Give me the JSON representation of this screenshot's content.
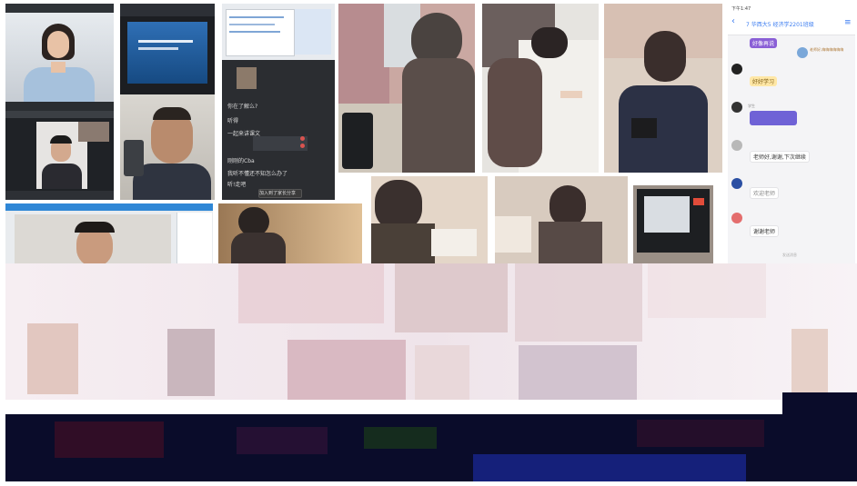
{
  "meeting_screen": {
    "messages": [
      "你在了解么?",
      "听得",
      "一起来讲课文",
      "刚刚的Cba",
      "我听不懂还不知怎么办了",
      "听!走吧"
    ],
    "bottom_button": "加入到了家长分享"
  },
  "chat": {
    "status_time": "下午1:47",
    "title": "7 华西大5 经济学2201班级",
    "sticker_1": "好像再说",
    "sticker_2": "好好学习",
    "sender_1": "老师好,嗨嗨嗨嗨嗨嗨",
    "sender_2": "学生",
    "message_greeting": "欢迎老师",
    "message_main": "老师好,谢谢,下次继续",
    "message_thanks": "谢谢老师",
    "footer": "发送消息"
  },
  "colors": {
    "chat_accent": "#3b7cf0",
    "sticker_purple": "#8a5fd6"
  }
}
